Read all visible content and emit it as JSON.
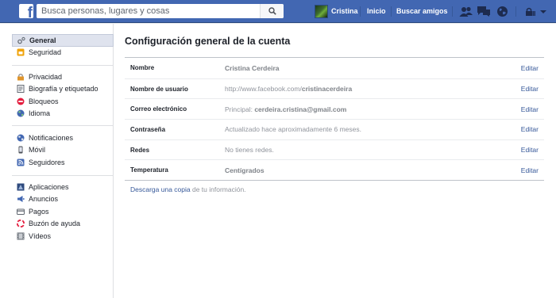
{
  "topbar": {
    "search_placeholder": "Busca personas, lugares y cosas",
    "profile_name": "Cristina",
    "home_label": "Inicio",
    "find_friends_label": "Buscar amigos",
    "brand_color": "#4267b2"
  },
  "sidebar": {
    "groups": [
      {
        "items": [
          {
            "label": "General",
            "icon": "gears-icon",
            "active": true
          },
          {
            "label": "Seguridad",
            "icon": "shield-badge-icon",
            "active": false
          }
        ]
      },
      {
        "items": [
          {
            "label": "Privacidad",
            "icon": "lock-icon",
            "active": false
          },
          {
            "label": "Biografía y etiquetado",
            "icon": "timeline-icon",
            "active": false
          },
          {
            "label": "Bloqueos",
            "icon": "block-icon",
            "active": false
          },
          {
            "label": "Idioma",
            "icon": "globe-icon",
            "active": false
          }
        ]
      },
      {
        "items": [
          {
            "label": "Notificaciones",
            "icon": "globe-notifications-icon",
            "active": false
          },
          {
            "label": "Móvil",
            "icon": "mobile-icon",
            "active": false
          },
          {
            "label": "Seguidores",
            "icon": "rss-icon",
            "active": false
          }
        ]
      },
      {
        "items": [
          {
            "label": "Aplicaciones",
            "icon": "apps-icon",
            "active": false
          },
          {
            "label": "Anuncios",
            "icon": "ads-icon",
            "active": false
          },
          {
            "label": "Pagos",
            "icon": "card-icon",
            "active": false
          },
          {
            "label": "Buzón de ayuda",
            "icon": "lifebuoy-icon",
            "active": false
          },
          {
            "label": "Vídeos",
            "icon": "film-icon",
            "active": false
          }
        ]
      }
    ]
  },
  "main": {
    "title": "Configuración general de la cuenta",
    "rows": [
      {
        "label": "Nombre",
        "value_prefix": "",
        "value_bold": "Cristina Cerdeira",
        "edit": "Editar"
      },
      {
        "label": "Nombre de usuario",
        "value_prefix": "http://www.facebook.com/",
        "value_bold": "cristinacerdeira",
        "edit": "Editar"
      },
      {
        "label": "Correo electrónico",
        "value_prefix": "Principal: ",
        "value_bold": "cerdeira.cristina@gmail.com",
        "edit": "Editar"
      },
      {
        "label": "Contraseña",
        "value_prefix": "Actualizado hace aproximadamente 6 meses.",
        "value_bold": "",
        "edit": "Editar"
      },
      {
        "label": "Redes",
        "value_prefix": "No tienes redes.",
        "value_bold": "",
        "edit": "Editar"
      },
      {
        "label": "Temperatura",
        "value_prefix": "",
        "value_bold": "Centígrados",
        "edit": "Editar"
      }
    ],
    "download": {
      "link": "Descarga una copia",
      "rest": " de tu información."
    }
  }
}
